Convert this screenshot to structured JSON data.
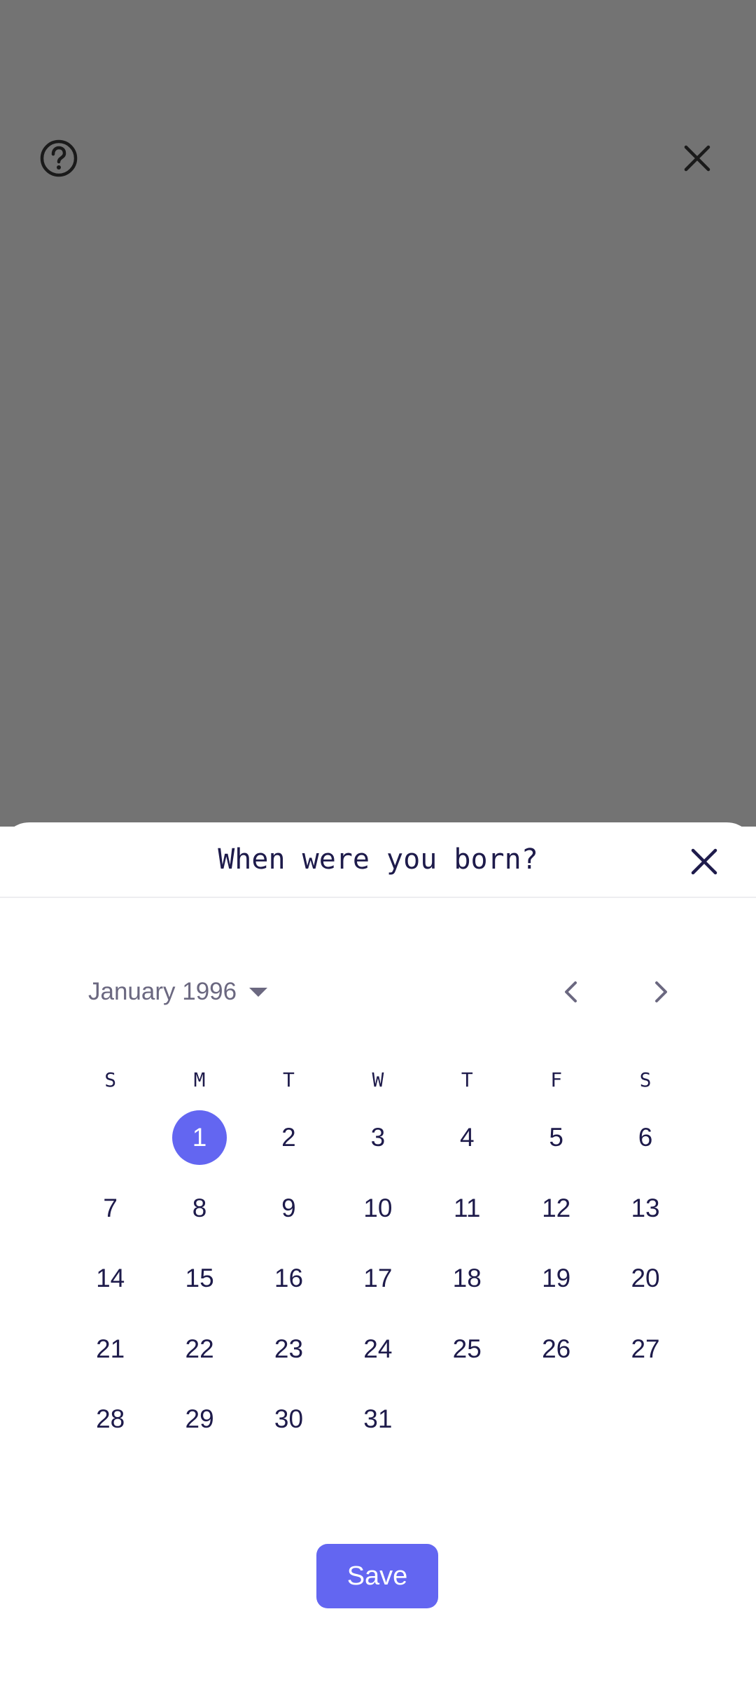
{
  "header_icons": {
    "help": "question-circle-icon",
    "close": "close-icon"
  },
  "dialog": {
    "title": "When were you born?",
    "close_icon": "close-icon"
  },
  "calendar": {
    "month_label": "January 1996",
    "prev_icon": "chevron-left-icon",
    "next_icon": "chevron-right-icon",
    "weekdays": [
      "S",
      "M",
      "T",
      "W",
      "T",
      "F",
      "S"
    ],
    "leading_blanks": 1,
    "days": [
      "1",
      "2",
      "3",
      "4",
      "5",
      "6",
      "7",
      "8",
      "9",
      "10",
      "11",
      "12",
      "13",
      "14",
      "15",
      "16",
      "17",
      "18",
      "19",
      "20",
      "21",
      "22",
      "23",
      "24",
      "25",
      "26",
      "27",
      "28",
      "29",
      "30",
      "31"
    ],
    "selected_day": "1"
  },
  "save_label": "Save",
  "colors": {
    "accent": "#6366f1",
    "text": "#1e1b4b",
    "muted": "#6b6880",
    "backdrop": "#737373"
  }
}
